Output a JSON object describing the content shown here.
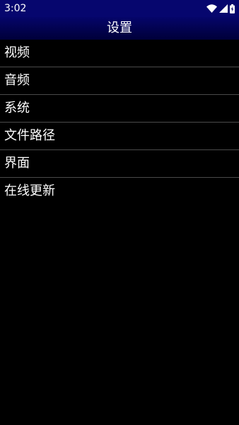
{
  "status_bar": {
    "time": "3:02",
    "icons": [
      "wifi-icon",
      "cellular-signal-icon",
      "battery-charging-icon"
    ]
  },
  "header": {
    "title": "设置"
  },
  "menu": {
    "items": [
      {
        "label": "视频"
      },
      {
        "label": "音频"
      },
      {
        "label": "系统"
      },
      {
        "label": "文件路径"
      },
      {
        "label": "界面"
      },
      {
        "label": "在线更新"
      }
    ]
  },
  "colors": {
    "status_bar_bg": "#06066e",
    "title_bar_bg": "#05056a",
    "background": "#000000",
    "divider": "#4a4a4a",
    "text": "#ffffff"
  }
}
